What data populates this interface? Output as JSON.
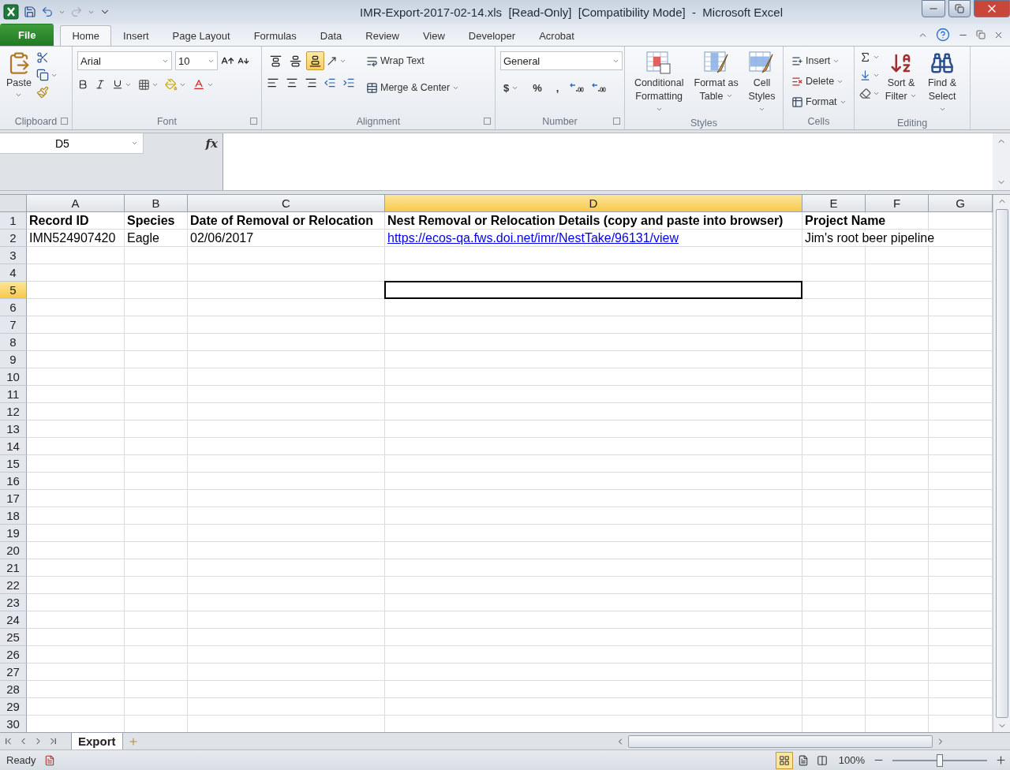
{
  "window": {
    "title": "IMR-Export-2017-02-14.xls  [Read-Only]  [Compatibility Mode]  -  Microsoft Excel"
  },
  "ribbon_tabs": [
    {
      "label": "File",
      "kind": "file",
      "selected": false
    },
    {
      "label": "Home",
      "kind": "tab",
      "selected": true
    },
    {
      "label": "Insert",
      "kind": "tab",
      "selected": false
    },
    {
      "label": "Page Layout",
      "kind": "tab",
      "selected": false
    },
    {
      "label": "Formulas",
      "kind": "tab",
      "selected": false
    },
    {
      "label": "Data",
      "kind": "tab",
      "selected": false
    },
    {
      "label": "Review",
      "kind": "tab",
      "selected": false
    },
    {
      "label": "View",
      "kind": "tab",
      "selected": false
    },
    {
      "label": "Developer",
      "kind": "tab",
      "selected": false
    },
    {
      "label": "Acrobat",
      "kind": "tab",
      "selected": false
    }
  ],
  "ribbon": {
    "clipboard": {
      "label": "Clipboard",
      "paste": "Paste"
    },
    "font": {
      "label": "Font",
      "font_name": "Arial",
      "font_size": "10"
    },
    "alignment": {
      "label": "Alignment",
      "vertical": [
        {
          "selected": false
        },
        {
          "selected": false
        },
        {
          "selected": true
        }
      ],
      "wrap_text": "Wrap Text",
      "merge": "Merge & Center"
    },
    "number": {
      "label": "Number",
      "format": "General",
      "symbols": [
        "$",
        "%",
        ","
      ]
    },
    "styles": {
      "label": "Styles",
      "buttons": [
        {
          "label": "Conditional Formatting"
        },
        {
          "label": "Format as Table"
        },
        {
          "label": "Cell Styles"
        }
      ]
    },
    "cells": {
      "label": "Cells",
      "buttons": [
        {
          "label": "Insert"
        },
        {
          "label": "Delete"
        },
        {
          "label": "Format"
        }
      ]
    },
    "editing": {
      "label": "Editing",
      "buttons": [
        {
          "label": "Sort & Filter"
        },
        {
          "label": "Find & Select"
        }
      ]
    }
  },
  "sheet": {
    "name_box": "D5",
    "function_label": "fx",
    "columns": [
      {
        "label": "A",
        "selected": false
      },
      {
        "label": "B",
        "selected": false
      },
      {
        "label": "C",
        "selected": false
      },
      {
        "label": "D",
        "selected": true
      },
      {
        "label": "E",
        "selected": false
      },
      {
        "label": "F",
        "selected": false
      },
      {
        "label": "G",
        "selected": false
      }
    ],
    "rows": [
      {
        "label": "1",
        "selected": false,
        "bold": true,
        "cells": [
          {
            "text": "Record ID",
            "kind": "text"
          },
          {
            "text": "Species",
            "kind": "text"
          },
          {
            "text": "Date of Removal or Relocation",
            "kind": "text"
          },
          {
            "text": "Nest Removal or Relocation Details (copy and paste into browser)",
            "kind": "text"
          },
          {
            "text": "Project Name",
            "kind": "text"
          }
        ]
      },
      {
        "label": "2",
        "selected": false,
        "bold": false,
        "cells": [
          {
            "text": "IMN524907420",
            "kind": "text"
          },
          {
            "text": "Eagle",
            "kind": "text"
          },
          {
            "text": "02/06/2017",
            "kind": "text"
          },
          {
            "text": "https://ecos-qa.fws.doi.net/imr/NestTake/96131/view",
            "kind": "link"
          },
          {
            "text": "Jim's root beer pipeline",
            "kind": "text"
          }
        ]
      },
      {
        "label": "3",
        "selected": false
      },
      {
        "label": "4",
        "selected": false
      },
      {
        "label": "5",
        "selected": true
      },
      {
        "label": "6",
        "selected": false
      },
      {
        "label": "7",
        "selected": false
      },
      {
        "label": "8",
        "selected": false
      },
      {
        "label": "9",
        "selected": false
      },
      {
        "label": "10",
        "selected": false
      },
      {
        "label": "11",
        "selected": false
      },
      {
        "label": "12",
        "selected": false
      },
      {
        "label": "13",
        "selected": false
      },
      {
        "label": "14",
        "selected": false
      },
      {
        "label": "15",
        "selected": false
      },
      {
        "label": "16",
        "selected": false
      },
      {
        "label": "17",
        "selected": false
      },
      {
        "label": "18",
        "selected": false
      },
      {
        "label": "19",
        "selected": false
      },
      {
        "label": "20",
        "selected": false
      },
      {
        "label": "21",
        "selected": false
      },
      {
        "label": "22",
        "selected": false
      },
      {
        "label": "23",
        "selected": false
      },
      {
        "label": "24",
        "selected": false
      },
      {
        "label": "25",
        "selected": false
      },
      {
        "label": "26",
        "selected": false
      },
      {
        "label": "27",
        "selected": false
      },
      {
        "label": "28",
        "selected": false
      },
      {
        "label": "29",
        "selected": false
      },
      {
        "label": "30",
        "selected": false
      }
    ]
  },
  "sheet_tabs": [
    {
      "label": "Export",
      "selected": true
    }
  ],
  "status_bar": {
    "status": "Ready",
    "views": [
      {
        "selected": true
      },
      {
        "selected": false
      },
      {
        "selected": false
      }
    ],
    "zoom": "100%",
    "zoom_slider": {
      "level": 0.5
    }
  }
}
